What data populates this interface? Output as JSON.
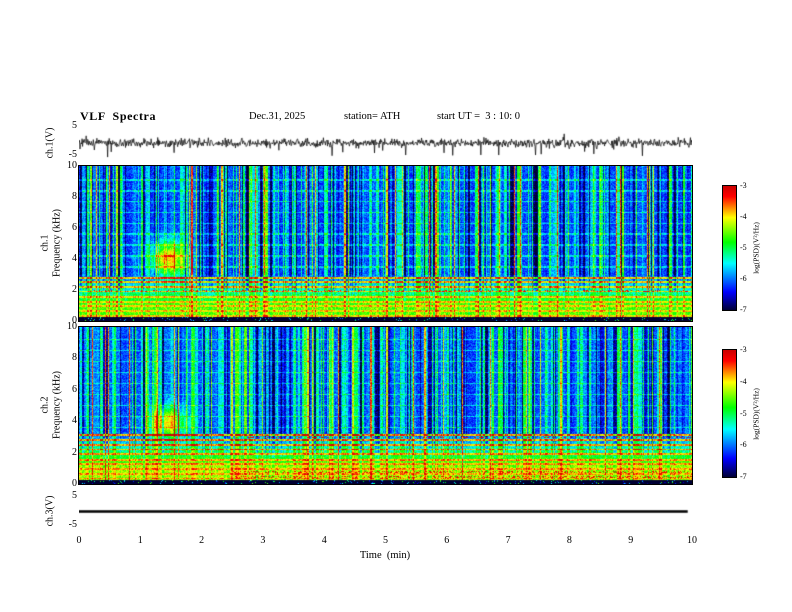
{
  "header": {
    "title": "VLF  Spectra",
    "date": "Dec.31, 2025",
    "station": "station= ATH",
    "start_ut": "start UT =  3 : 10: 0"
  },
  "x_axis": {
    "label": "Time  (min)",
    "ticks": [
      "0",
      "1",
      "2",
      "3",
      "4",
      "5",
      "6",
      "7",
      "8",
      "9",
      "10"
    ],
    "range_min": [
      0,
      10
    ]
  },
  "panels": {
    "ch1_wave": {
      "ylabel": "ch.1(V)",
      "yticks": [
        "5",
        "-5"
      ],
      "ylim": [
        -5,
        5
      ]
    },
    "ch1_spec": {
      "ylabel_line1": "ch.1",
      "ylabel_line2": "Frequency  (kHz)",
      "yticks": [
        "10",
        "8",
        "6",
        "4",
        "2",
        "0"
      ],
      "ylim_khz": [
        0,
        10
      ]
    },
    "ch2_spec": {
      "ylabel_line1": "ch.2",
      "ylabel_line2": "Frequency  (kHz)",
      "yticks": [
        "10",
        "8",
        "6",
        "4",
        "2",
        "0"
      ],
      "ylim_khz": [
        0,
        10
      ]
    },
    "ch3_wave": {
      "ylabel": "ch.3(V)",
      "yticks": [
        "5",
        "-5"
      ],
      "ylim": [
        -5,
        5
      ]
    }
  },
  "colorbar": {
    "label": "log(PSD)(V²/Hz)",
    "ticks": [
      "-3",
      "-4",
      "-5",
      "-6",
      "-7"
    ],
    "range": [
      -7,
      -3
    ],
    "colormap_stops": [
      [
        0.0,
        [
          0,
          0,
          50
        ]
      ],
      [
        0.15,
        [
          0,
          0,
          255
        ]
      ],
      [
        0.38,
        [
          0,
          255,
          255
        ]
      ],
      [
        0.55,
        [
          0,
          255,
          0
        ]
      ],
      [
        0.75,
        [
          255,
          255,
          0
        ]
      ],
      [
        0.92,
        [
          255,
          0,
          0
        ]
      ],
      [
        1.0,
        [
          205,
          0,
          0
        ]
      ]
    ]
  },
  "chart_data": [
    {
      "id": "wave1",
      "type": "line",
      "panel": "ch.1 (V) time series",
      "x_range_min": [
        0,
        10
      ],
      "ylim": [
        -5,
        5
      ],
      "description": "Broadband noisy voltage trace centred on 0 V with ~±1 V fluctuations and frequent impulsive spikes reaching about -4 V and +3 V",
      "seed": 7,
      "n": 1200,
      "noise_sigma": 0.55,
      "spike_neg_prob": 0.02,
      "spike_pos_prob": 0.007,
      "spike_amp": [
        1.2,
        3.8
      ]
    },
    {
      "id": "spec1",
      "type": "heatmap",
      "panel": "ch.1 spectrogram",
      "x_range_min": [
        0,
        10
      ],
      "freq_range_khz": [
        0,
        10
      ],
      "z_range": [
        -7,
        -3
      ],
      "z_label": "log(PSD)(V²/Hz)",
      "description": "VLF spectrogram: blue background (~-6) with dense broadband vertical sferic streaks (cyan/green), enhanced green-yellow power below ~3 kHz with narrow harmonic lines, red segments near 2 kHz, dark band at 0 kHz, strong emission patch near t=1.5 min around 4 kHz",
      "seed": 42,
      "base_level": -6.15,
      "low_freq": {
        "below_khz": 3.0,
        "peak_level": -4.55
      },
      "bright_bands_khz": [
        0.35,
        0.65,
        0.95,
        1.25,
        1.55,
        1.9,
        2.2,
        2.5,
        2.8
      ],
      "band_level": -3.95,
      "faint_lines_khz": [
        3.5,
        4.2,
        4.9,
        5.6,
        6.3,
        7.0,
        7.7,
        8.4,
        9.1
      ],
      "blob": {
        "t_min": 1.45,
        "f_khz": 4.0,
        "sigma_t": 0.2,
        "sigma_f": 0.8,
        "amp": 2.3
      },
      "speckle": {
        "t_start_min": 0.2,
        "freqs_khz": [
          1.95
        ],
        "prob": 0.22,
        "level": -3.2
      },
      "streaks": {
        "strong_prob": 0.1,
        "strong_amp": 2.1,
        "mod_prob": 0.28,
        "mod_amp": 0.9,
        "dark_prob": 0.2,
        "dark_amp": -0.7
      }
    },
    {
      "id": "spec2",
      "type": "heatmap",
      "panel": "ch.2 spectrogram",
      "x_range_min": [
        0,
        10
      ],
      "freq_range_khz": [
        0,
        10
      ],
      "z_range": [
        -7,
        -3
      ],
      "z_label": "log(PSD)(V²/Hz)",
      "description": "Similar to ch.1 but with stronger/brighter green-yellow low-frequency band up to ~3 kHz and red speckled rows below 1 kHz and near 3 kHz in the second half",
      "seed": 1337,
      "base_level": -6.1,
      "low_freq": {
        "below_khz": 3.2,
        "peak_level": -4.35
      },
      "bright_bands_khz": [
        0.35,
        0.65,
        0.95,
        1.25,
        1.55,
        1.9,
        2.2,
        2.5,
        2.8,
        3.1
      ],
      "band_level": -3.8,
      "faint_lines_khz": [
        3.6,
        4.3,
        5.0,
        5.7,
        6.4,
        7.1,
        7.8,
        8.5,
        9.2
      ],
      "blob": {
        "t_min": 1.45,
        "f_khz": 3.9,
        "sigma_t": 0.2,
        "sigma_f": 0.7,
        "amp": 2.0
      },
      "speckle": {
        "t_start_min": 2.5,
        "freqs_khz": [
          0.45,
          0.75,
          2.95
        ],
        "prob": 0.28,
        "level": -3.2
      },
      "streaks": {
        "strong_prob": 0.1,
        "strong_amp": 2.0,
        "mod_prob": 0.3,
        "mod_amp": 0.9,
        "dark_prob": 0.18,
        "dark_amp": -0.7
      }
    },
    {
      "id": "wave3",
      "type": "line",
      "panel": "ch.3 (V) time series",
      "x_range_min": [
        0,
        10
      ],
      "ylim": [
        -5,
        5
      ],
      "description": "Flat thick black line at 0 V (no signal)",
      "constant": 0,
      "linewidth": 2.6
    }
  ]
}
